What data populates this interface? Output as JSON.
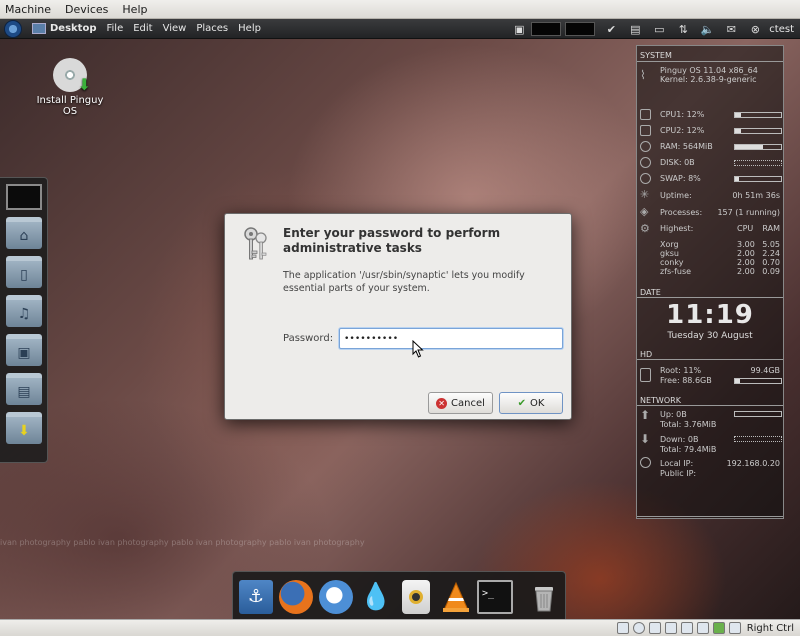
{
  "host_menu": {
    "items": [
      "Machine",
      "Devices",
      "Help"
    ]
  },
  "panel": {
    "desktop": "Desktop",
    "menus": [
      "File",
      "Edit",
      "View",
      "Places",
      "Help"
    ],
    "user": "ctest"
  },
  "desktop_icons": [
    {
      "label": "Install Pinguy OS",
      "icon": "cd-install-icon"
    }
  ],
  "dialog": {
    "title": "Enter your password to perform administrative tasks",
    "message": "The application '/usr/sbin/synaptic' lets you modify essential parts of your system.",
    "password_label": "Password:",
    "password_value": "••••••••••",
    "cancel_label": "Cancel",
    "ok_label": "OK"
  },
  "conky": {
    "system_header": "SYSTEM",
    "os": "Pinguy OS 11.04 x86_64",
    "kernel": "Kernel: 2.6.38-9-generic",
    "cpu1": "CPU1: 12%",
    "cpu1_level": 12,
    "cpu2": "CPU2: 12%",
    "cpu2_level": 12,
    "ram": "RAM: 564MiB",
    "ram_level": 60,
    "disk": "DISK: 0B",
    "swap": "SWAP: 8%",
    "swap_level": 8,
    "uptime_label": "Uptime:",
    "uptime_value": "0h 51m 36s",
    "processes_label": "Processes:",
    "processes_value": "157 (1 running)",
    "highest_label": "Highest:",
    "cpu_col": "CPU",
    "ram_col": "RAM",
    "procs": [
      {
        "name": "Xorg",
        "cpu": "3.00",
        "ram": "5.05"
      },
      {
        "name": "gksu",
        "cpu": "2.00",
        "ram": "2.24"
      },
      {
        "name": "conky",
        "cpu": "2.00",
        "ram": "0.70"
      },
      {
        "name": "zfs-fuse",
        "cpu": "2.00",
        "ram": "0.09"
      }
    ],
    "date_header": "DATE",
    "time": "11:19",
    "date": "Tuesday 30 August",
    "hd_header": "HD",
    "root": "Root: 11%",
    "root_size": "99.4GB",
    "root_level": 11,
    "free": "Free: 88.6GB",
    "network_header": "NETWORK",
    "up": "Up: 0B",
    "up_total": "Total: 3.76MiB",
    "down": "Down: 0B",
    "down_total": "Total: 79.4MiB",
    "local_ip_label": "Local IP:",
    "local_ip": "192.168.0.20",
    "public_ip_label": "Public IP:"
  },
  "watermark": "ivan photography pablo ivan photography pablo ivan photography pablo ivan photography",
  "status_bar": {
    "host_key": "Right Ctrl"
  }
}
